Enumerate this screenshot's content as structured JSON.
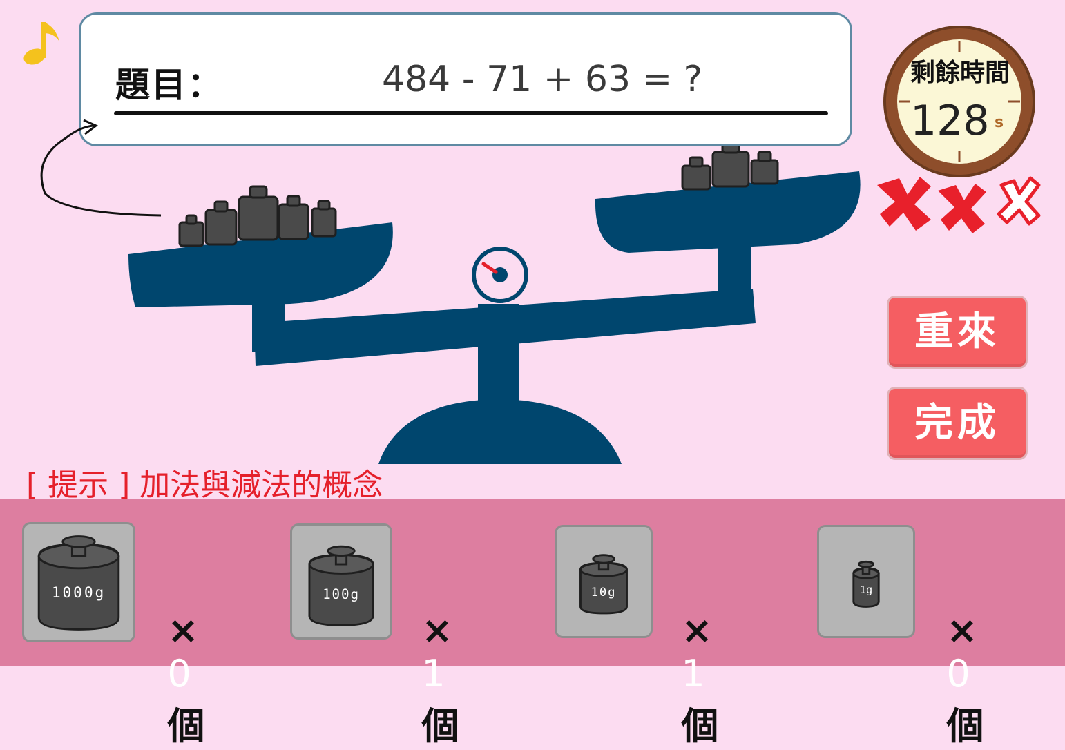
{
  "question": {
    "label": "題目：",
    "expression": "484 - 71 + 63 = ?"
  },
  "timer": {
    "title": "剩餘時間",
    "value": "128",
    "unit": "s"
  },
  "lives": {
    "lost": 2,
    "remaining": 1
  },
  "buttons": {
    "retry": "重來",
    "done": "完成"
  },
  "hint": "[ 提示 ] 加法與減法的概念",
  "weights": [
    {
      "label": "1000g",
      "times": "×",
      "count": "0",
      "unit": "個"
    },
    {
      "label": "100g",
      "times": "×",
      "count": "1",
      "unit": "個"
    },
    {
      "label": "10g",
      "times": "×",
      "count": "1",
      "unit": "個"
    },
    {
      "label": "1g",
      "times": "×",
      "count": "0",
      "unit": "個"
    }
  ],
  "colors": {
    "background": "#fcdcf1",
    "scale": "#00466e",
    "button": "#f55e62",
    "tray": "#dd7ea0",
    "hint": "#e5202b",
    "mark": "#e8202b"
  }
}
